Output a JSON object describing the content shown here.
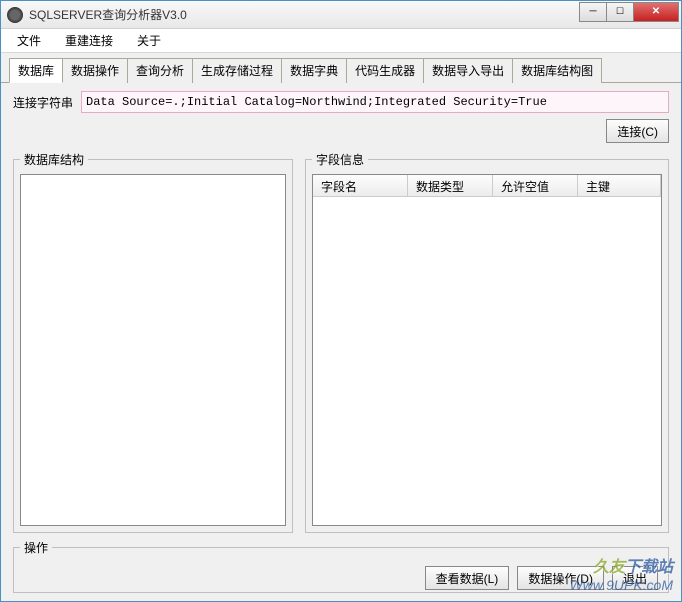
{
  "window": {
    "title": "SQLSERVER查询分析器V3.0"
  },
  "menu": {
    "file": "文件",
    "reconnect": "重建连接",
    "about": "关于"
  },
  "tabs": [
    "数据库",
    "数据操作",
    "查询分析",
    "生成存储过程",
    "数据字典",
    "代码生成器",
    "数据导入导出",
    "数据库结构图"
  ],
  "conn": {
    "label": "连接字符串",
    "value": "Data Source=.;Initial Catalog=Northwind;Integrated Security=True",
    "connect_btn": "连接(C)"
  },
  "panels": {
    "db_structure": "数据库结构",
    "field_info": "字段信息",
    "columns": [
      "字段名",
      "数据类型",
      "允许空值",
      "主键"
    ],
    "ops": "操作"
  },
  "buttons": {
    "view_data": "查看数据(L)",
    "data_ops": "数据操作(D)",
    "exit": "退出"
  },
  "watermark": {
    "line1a": "久友",
    "line1b": "下载站",
    "line2": "Www.9UPK.coM"
  }
}
